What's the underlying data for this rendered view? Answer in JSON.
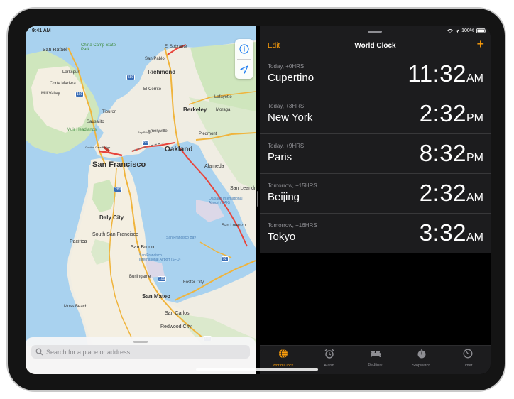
{
  "status": {
    "time": "9:41 AM",
    "battery": "100%"
  },
  "map": {
    "search_placeholder": "Search for a place or address",
    "labels": [
      {
        "text": "China Camp State Park",
        "size": 6,
        "color": "#3d8b3d"
      },
      {
        "text": "San Rafael",
        "size": 7,
        "color": "#333"
      },
      {
        "text": "El Sobrante",
        "size": 6,
        "color": "#333"
      },
      {
        "text": "San Pablo",
        "size": 6,
        "color": "#333"
      },
      {
        "text": "Larkspur",
        "size": 6,
        "color": "#333"
      },
      {
        "text": "Richmond",
        "size": 8,
        "color": "#333"
      },
      {
        "text": "Corte Madera",
        "size": 6,
        "color": "#333"
      },
      {
        "text": "El Cerrito",
        "size": 6,
        "color": "#333"
      },
      {
        "text": "Lafayette",
        "size": 6,
        "color": "#333"
      },
      {
        "text": "Mill Valley",
        "size": 6,
        "color": "#333"
      },
      {
        "text": "Berkeley",
        "size": 8,
        "color": "#333"
      },
      {
        "text": "Moraga",
        "size": 6,
        "color": "#333"
      },
      {
        "text": "Tiburon",
        "size": 6,
        "color": "#333"
      },
      {
        "text": "Sausalito",
        "size": 6,
        "color": "#333"
      },
      {
        "text": "Piedmont",
        "size": 6,
        "color": "#333"
      },
      {
        "text": "Muir Headlands",
        "size": 6,
        "color": "#3d8b3d"
      },
      {
        "text": "Emeryville",
        "size": 6,
        "color": "#333"
      },
      {
        "text": "Oakland",
        "size": 10,
        "color": "#333"
      },
      {
        "text": "San Francisco",
        "size": 11,
        "color": "#333"
      },
      {
        "text": "Alameda",
        "size": 7,
        "color": "#333"
      },
      {
        "text": "San Leandro",
        "size": 7,
        "color": "#333"
      },
      {
        "text": "Oakland International Airport (OAK)",
        "size": 5,
        "color": "#4a7fb5"
      },
      {
        "text": "Daly City",
        "size": 8,
        "color": "#333"
      },
      {
        "text": "San Lorenzo",
        "size": 6,
        "color": "#333"
      },
      {
        "text": "South San Francisco",
        "size": 7,
        "color": "#333"
      },
      {
        "text": "Pacifica",
        "size": 7,
        "color": "#333"
      },
      {
        "text": "San Francisco Bay",
        "size": 5,
        "color": "#4a7fb5"
      },
      {
        "text": "San Bruno",
        "size": 7,
        "color": "#333"
      },
      {
        "text": "San Francisco International Airport (SFO)",
        "size": 5,
        "color": "#4a7fb5"
      },
      {
        "text": "Burlingame",
        "size": 6,
        "color": "#333"
      },
      {
        "text": "Foster City",
        "size": 6,
        "color": "#333"
      },
      {
        "text": "San Mateo",
        "size": 8,
        "color": "#333"
      },
      {
        "text": "Moss Beach",
        "size": 6,
        "color": "#333"
      },
      {
        "text": "San Carlos",
        "size": 7,
        "color": "#333"
      },
      {
        "text": "Redwood City",
        "size": 7,
        "color": "#333"
      },
      {
        "text": "Golden Gate Bridge",
        "size": 4,
        "color": "#333"
      },
      {
        "text": "Bay Bridge",
        "size": 4,
        "color": "#333"
      }
    ],
    "shields": [
      "101",
      "580",
      "80",
      "280",
      "92",
      "101",
      "101"
    ]
  },
  "clock": {
    "edit_label": "Edit",
    "title": "World Clock",
    "add_label": "+",
    "accent": "#ff9f0a",
    "rows": [
      {
        "offset": "Today, +0HRS",
        "city": "Cupertino",
        "time": "11:32",
        "ampm": "AM"
      },
      {
        "offset": "Today, +3HRS",
        "city": "New York",
        "time": "2:32",
        "ampm": "PM"
      },
      {
        "offset": "Today, +9HRS",
        "city": "Paris",
        "time": "8:32",
        "ampm": "PM"
      },
      {
        "offset": "Tomorrow, +15HRS",
        "city": "Beijing",
        "time": "2:32",
        "ampm": "AM"
      },
      {
        "offset": "Tomorrow, +16HRS",
        "city": "Tokyo",
        "time": "3:32",
        "ampm": "AM"
      }
    ],
    "tabs": [
      {
        "label": "World Clock",
        "icon": "globe-icon",
        "active": true
      },
      {
        "label": "Alarm",
        "icon": "alarm-icon",
        "active": false
      },
      {
        "label": "Bedtime",
        "icon": "bed-icon",
        "active": false
      },
      {
        "label": "Stopwatch",
        "icon": "stopwatch-icon",
        "active": false
      },
      {
        "label": "Timer",
        "icon": "timer-icon",
        "active": false
      }
    ]
  }
}
